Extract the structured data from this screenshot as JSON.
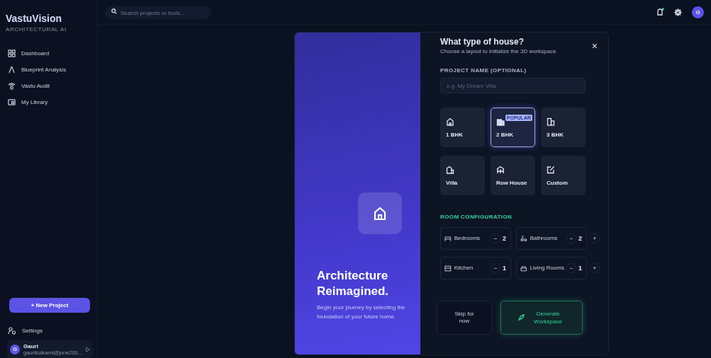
{
  "sidebar": {
    "brand": "VastuVision",
    "tagline": "ARCHITECTURAL AI",
    "items": [
      {
        "label": "Dashboard",
        "selected": false
      },
      {
        "label": "Blueprint Analysis",
        "selected": false
      },
      {
        "label": "Vastu Audit",
        "selected": false
      },
      {
        "label": "My Library",
        "selected": false
      }
    ],
    "new_project": "+ New Project",
    "settings": "Settings",
    "user": {
      "initial": "G",
      "name": "Gauri",
      "email": "gaurikulkarni@june200..."
    }
  },
  "topbar": {
    "search": {
      "placeholder": "Search projects or tools..."
    },
    "avatar": "G",
    "notification": true
  },
  "modal": {
    "hero": {
      "title": "Architecture Reimagined.",
      "text": "Begin your journey by selecting the foundation of your future home."
    },
    "title": "What type of house?",
    "subtitle": "Choose a layout to initialize the 3D workspace",
    "close": "×",
    "name_label": "PROJECT NAME (OPTIONAL)",
    "name_field": {
      "placeholder": "e.g. My Dream Villa"
    },
    "types": [
      {
        "label": "1 BHK",
        "selected": false
      },
      {
        "label": "2 BHK",
        "selected": true,
        "badge": "POPULAR"
      },
      {
        "label": "3 BHK",
        "selected": false
      },
      {
        "label": "Villa",
        "selected": false
      },
      {
        "label": "Row House",
        "selected": false
      },
      {
        "label": "Custom",
        "selected": false
      }
    ],
    "rooms_label": "ROOM CONFIGURATION",
    "rooms": [
      {
        "label": "Bedrooms",
        "minus": "−",
        "value": "2"
      },
      {
        "label": "Bathrooms",
        "minus": "−",
        "value": "2",
        "plus": "+"
      },
      {
        "label": "Kitchen",
        "minus": "−",
        "value": "1"
      },
      {
        "label": "Living Rooms",
        "minus": "−",
        "value": "1",
        "plus": "+"
      }
    ],
    "skip": "Skip for now",
    "generate": "Generate Workspace"
  }
}
